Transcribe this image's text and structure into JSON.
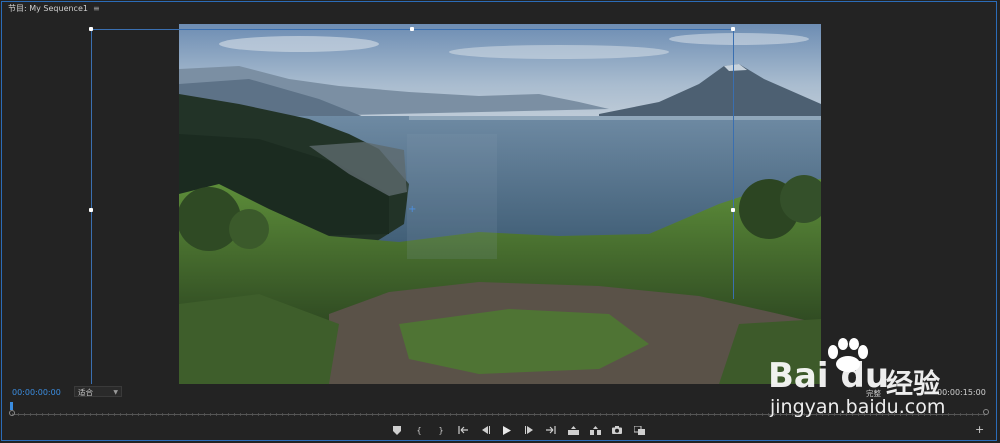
{
  "panel": {
    "title": "节目: My Sequence1",
    "menu_icon": "hamburger-icon"
  },
  "viewer": {
    "image": "lake-volcano-landscape"
  },
  "controls": {
    "timecode_current": "00:00:00:00",
    "fit_value": "适合",
    "quality_label": "完整",
    "timecode_duration": "00:00:15:00"
  },
  "transport": [
    {
      "name": "marker-icon",
      "glyph": "⬥"
    },
    {
      "name": "mark-in-icon",
      "glyph": "{"
    },
    {
      "name": "mark-out-icon",
      "glyph": "}"
    },
    {
      "name": "go-to-in-icon",
      "glyph": "{←"
    },
    {
      "name": "step-back-icon",
      "glyph": "◂|"
    },
    {
      "name": "play-icon",
      "glyph": "▶"
    },
    {
      "name": "step-forward-icon",
      "glyph": "|▸"
    },
    {
      "name": "go-to-out-icon",
      "glyph": "→}"
    },
    {
      "name": "lift-icon",
      "glyph": "⏏"
    },
    {
      "name": "extract-icon",
      "glyph": "⏏"
    },
    {
      "name": "export-frame-icon",
      "glyph": "◙"
    },
    {
      "name": "compare-view-icon",
      "glyph": "⧉"
    }
  ],
  "watermark": {
    "brand": "Bai",
    "brand2": "du",
    "cn": "经验",
    "url": "jingyan.baidu.com"
  },
  "colors": {
    "accent": "#3b8de0",
    "panel_border": "#2b6cb8",
    "background": "#232323"
  }
}
